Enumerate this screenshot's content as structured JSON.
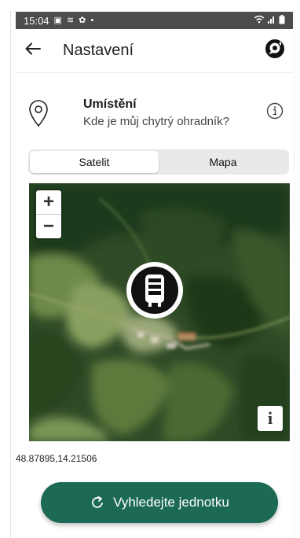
{
  "statusbar": {
    "time": "15:04"
  },
  "header": {
    "title": "Nastavení"
  },
  "location": {
    "title": "Umístění",
    "subtitle": "Kde je můj chytrý ohradník?"
  },
  "map_type": {
    "options": [
      "Satelit",
      "Mapa"
    ],
    "selected": "Satelit"
  },
  "map": {
    "zoom_in": "+",
    "zoom_out": "−",
    "info": "i"
  },
  "coordinates": "48.87895,14.21506",
  "search_button": {
    "label": "Vyhledejte jednotku"
  },
  "colors": {
    "accent": "#1c6a56",
    "statusbar": "#4c4c4c"
  }
}
